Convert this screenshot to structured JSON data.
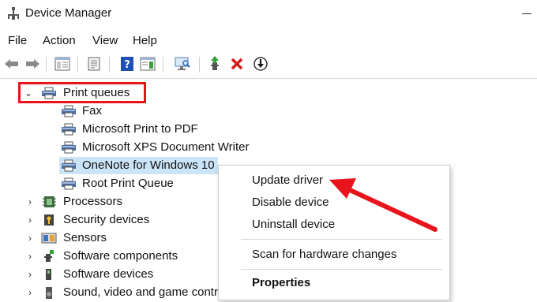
{
  "window": {
    "title": "Device Manager",
    "minimize_symbol": "—"
  },
  "menu": [
    "File",
    "Action",
    "View",
    "Help"
  ],
  "toolbar": {
    "buttons": [
      "back-icon",
      "forward-icon",
      "show-hide-console-tree-icon",
      "properties-icon",
      "help-icon",
      "action-pane-icon",
      "scan-hardware-icon",
      "update-driver-icon",
      "uninstall-icon",
      "install-legacy-icon"
    ]
  },
  "tree": {
    "print_queues": {
      "label": "Print queues",
      "children": [
        "Fax",
        "Microsoft Print to PDF",
        "Microsoft XPS Document Writer",
        "OneNote for Windows 10",
        "Root Print Queue"
      ],
      "selected": "OneNote for Windows 10"
    },
    "categories": [
      "Processors",
      "Security devices",
      "Sensors",
      "Software components",
      "Software devices",
      "Sound, video and game contr"
    ]
  },
  "context_menu": {
    "items": [
      "Update driver",
      "Disable device",
      "Uninstall device",
      "Scan for hardware changes",
      "Properties"
    ],
    "default_item": "Properties"
  },
  "annotation": {
    "highlight_color": "#e8141c",
    "arrow_color": "#e8141c"
  }
}
